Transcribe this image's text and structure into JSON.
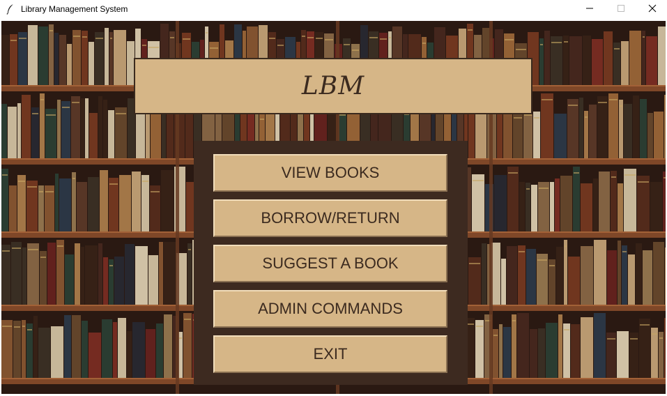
{
  "window": {
    "title": "Library Management System",
    "icon": "feather-icon",
    "controls": {
      "minimize_icon": "minimize-icon",
      "maximize_icon": "maximize-icon",
      "close_icon": "close-icon"
    }
  },
  "header": {
    "title": "LBM"
  },
  "menu": {
    "view_books": "VIEW BOOKS",
    "borrow_return": "BORROW/RETURN",
    "suggest_book": "SUGGEST A BOOK",
    "admin_commands": "ADMIN COMMANDS",
    "exit": "EXIT"
  },
  "colors": {
    "accent_tan": "#d6b687",
    "panel_brown": "#3d2a20",
    "text_dark": "#3b2a1f"
  }
}
